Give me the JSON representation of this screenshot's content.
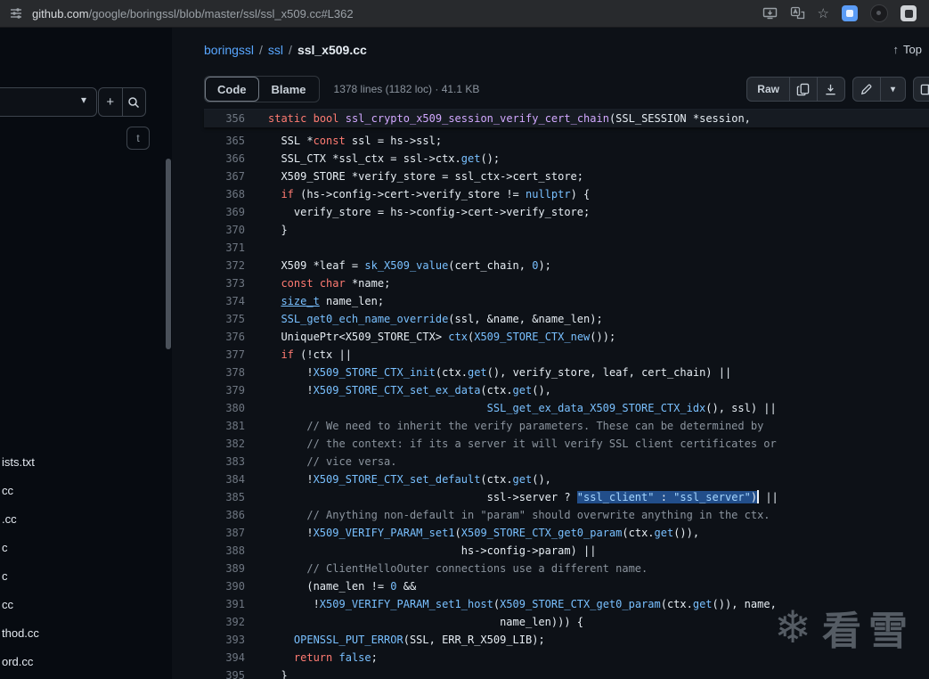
{
  "browser": {
    "url_domain": "github.com",
    "url_path": "/google/boringssl/blob/master/ssl/ssl_x509.cc#L362"
  },
  "icons": {
    "star": "☆",
    "caret_down": "▾",
    "up_arrow": "↑",
    "plus": "+"
  },
  "sidebar": {
    "shortcut_key": "t",
    "files": [
      "ists.txt",
      "cc",
      ".cc",
      "c",
      "c",
      "cc",
      "thod.cc",
      "ord.cc"
    ]
  },
  "breadcrumb": {
    "repo": "boringssl",
    "separator": "/",
    "dir": "ssl",
    "file": "ssl_x509.cc"
  },
  "header": {
    "top_label": "Top"
  },
  "toolbar": {
    "code_label": "Code",
    "blame_label": "Blame",
    "file_info": "1378 lines (1182 loc) · 41.1 KB",
    "raw_label": "Raw"
  },
  "watermark": {
    "icon": "❄",
    "text": "看雪"
  },
  "code": {
    "lines": [
      {
        "n": "356",
        "sticky": true,
        "t": [
          [
            "k",
            "static"
          ],
          [
            "p",
            " "
          ],
          [
            "k",
            "bool"
          ],
          [
            "p",
            " "
          ],
          [
            "d",
            "ssl_crypto_x509_session_verify_cert_chain"
          ],
          [
            "p",
            "(SSL_SESSION *session,"
          ]
        ]
      },
      {
        "n": "365",
        "t": [
          [
            "p",
            "  SSL *"
          ],
          [
            "k",
            "const"
          ],
          [
            "p",
            " ssl = hs->ssl;"
          ]
        ]
      },
      {
        "n": "366",
        "t": [
          [
            "p",
            "  SSL_CTX *ssl_ctx = ssl->ctx."
          ],
          [
            "f",
            "get"
          ],
          [
            "p",
            "();"
          ]
        ]
      },
      {
        "n": "367",
        "t": [
          [
            "p",
            "  X509_STORE *verify_store = ssl_ctx->cert_store;"
          ]
        ]
      },
      {
        "n": "368",
        "t": [
          [
            "p",
            "  "
          ],
          [
            "k",
            "if"
          ],
          [
            "p",
            " (hs->config->cert->verify_store != "
          ],
          [
            "f",
            "nullptr"
          ],
          [
            "p",
            ") {"
          ]
        ]
      },
      {
        "n": "369",
        "t": [
          [
            "p",
            "    verify_store = hs->config->cert->verify_store;"
          ]
        ]
      },
      {
        "n": "370",
        "t": [
          [
            "p",
            "  }"
          ]
        ]
      },
      {
        "n": "371",
        "t": [
          [
            "p",
            ""
          ]
        ]
      },
      {
        "n": "372",
        "t": [
          [
            "p",
            "  X509 *leaf = "
          ],
          [
            "f",
            "sk_X509_value"
          ],
          [
            "p",
            "(cert_chain, "
          ],
          [
            "f",
            "0"
          ],
          [
            "p",
            ");"
          ]
        ]
      },
      {
        "n": "373",
        "t": [
          [
            "p",
            "  "
          ],
          [
            "k",
            "const"
          ],
          [
            "p",
            " "
          ],
          [
            "k",
            "char"
          ],
          [
            "p",
            " *name;"
          ]
        ]
      },
      {
        "n": "374",
        "t": [
          [
            "p",
            "  "
          ],
          [
            "u",
            "size_t"
          ],
          [
            "p",
            " name_len;"
          ]
        ]
      },
      {
        "n": "375",
        "t": [
          [
            "p",
            "  "
          ],
          [
            "f",
            "SSL_get0_ech_name_override"
          ],
          [
            "p",
            "(ssl, &name, &name_len);"
          ]
        ]
      },
      {
        "n": "376",
        "t": [
          [
            "p",
            "  UniquePtr<X509_STORE_CTX> "
          ],
          [
            "f",
            "ctx"
          ],
          [
            "p",
            "("
          ],
          [
            "f",
            "X509_STORE_CTX_new"
          ],
          [
            "p",
            "());"
          ]
        ]
      },
      {
        "n": "377",
        "t": [
          [
            "p",
            "  "
          ],
          [
            "k",
            "if"
          ],
          [
            "p",
            " (!ctx ||"
          ]
        ]
      },
      {
        "n": "378",
        "t": [
          [
            "p",
            "      !"
          ],
          [
            "f",
            "X509_STORE_CTX_init"
          ],
          [
            "p",
            "(ctx."
          ],
          [
            "f",
            "get"
          ],
          [
            "p",
            "(), verify_store, leaf, cert_chain) ||"
          ]
        ]
      },
      {
        "n": "379",
        "t": [
          [
            "p",
            "      !"
          ],
          [
            "f",
            "X509_STORE_CTX_set_ex_data"
          ],
          [
            "p",
            "(ctx."
          ],
          [
            "f",
            "get"
          ],
          [
            "p",
            "(),"
          ]
        ]
      },
      {
        "n": "380",
        "t": [
          [
            "p",
            "                                  "
          ],
          [
            "f",
            "SSL_get_ex_data_X509_STORE_CTX_idx"
          ],
          [
            "p",
            "(), ssl) ||"
          ]
        ]
      },
      {
        "n": "381",
        "t": [
          [
            "c",
            "      // We need to inherit the verify parameters. These can be determined by"
          ]
        ]
      },
      {
        "n": "382",
        "t": [
          [
            "c",
            "      // the context: if its a server it will verify SSL client certificates or"
          ]
        ]
      },
      {
        "n": "383",
        "t": [
          [
            "c",
            "      // vice versa."
          ]
        ]
      },
      {
        "n": "384",
        "t": [
          [
            "p",
            "      !"
          ],
          [
            "f",
            "X509_STORE_CTX_set_default"
          ],
          [
            "p",
            "(ctx."
          ],
          [
            "f",
            "get"
          ],
          [
            "p",
            "(),"
          ]
        ]
      },
      {
        "n": "385",
        "t": [
          [
            "p",
            "                                  ssl->server ? "
          ],
          [
            "ss",
            "\"ssl_client\""
          ],
          [
            "ps",
            " : "
          ],
          [
            "ss",
            "\"ssl_server\""
          ],
          [
            "ps",
            ")"
          ],
          [
            "caret",
            ""
          ],
          [
            "p",
            " ||"
          ]
        ]
      },
      {
        "n": "386",
        "t": [
          [
            "c",
            "      // Anything non-default in \"param\" should overwrite anything in the ctx."
          ]
        ]
      },
      {
        "n": "387",
        "t": [
          [
            "p",
            "      !"
          ],
          [
            "f",
            "X509_VERIFY_PARAM_set1"
          ],
          [
            "p",
            "("
          ],
          [
            "f",
            "X509_STORE_CTX_get0_param"
          ],
          [
            "p",
            "(ctx."
          ],
          [
            "f",
            "get"
          ],
          [
            "p",
            "()),"
          ]
        ]
      },
      {
        "n": "388",
        "t": [
          [
            "p",
            "                              hs->config->param) ||"
          ]
        ]
      },
      {
        "n": "389",
        "t": [
          [
            "c",
            "      // ClientHelloOuter connections use a different name."
          ]
        ]
      },
      {
        "n": "390",
        "t": [
          [
            "p",
            "      (name_len != "
          ],
          [
            "f",
            "0"
          ],
          [
            "p",
            " &&"
          ]
        ]
      },
      {
        "n": "391",
        "t": [
          [
            "p",
            "       !"
          ],
          [
            "f",
            "X509_VERIFY_PARAM_set1_host"
          ],
          [
            "p",
            "("
          ],
          [
            "f",
            "X509_STORE_CTX_get0_param"
          ],
          [
            "p",
            "(ctx."
          ],
          [
            "f",
            "get"
          ],
          [
            "p",
            "()), name,"
          ]
        ]
      },
      {
        "n": "392",
        "t": [
          [
            "p",
            "                                    name_len))) {"
          ]
        ]
      },
      {
        "n": "393",
        "t": [
          [
            "p",
            "    "
          ],
          [
            "f",
            "OPENSSL_PUT_ERROR"
          ],
          [
            "p",
            "(SSL, ERR_R_X509_LIB);"
          ]
        ]
      },
      {
        "n": "394",
        "t": [
          [
            "p",
            "    "
          ],
          [
            "k",
            "return"
          ],
          [
            "p",
            " "
          ],
          [
            "f",
            "false"
          ],
          [
            "p",
            ";"
          ]
        ]
      },
      {
        "n": "395",
        "t": [
          [
            "p",
            "  }"
          ]
        ]
      }
    ]
  }
}
